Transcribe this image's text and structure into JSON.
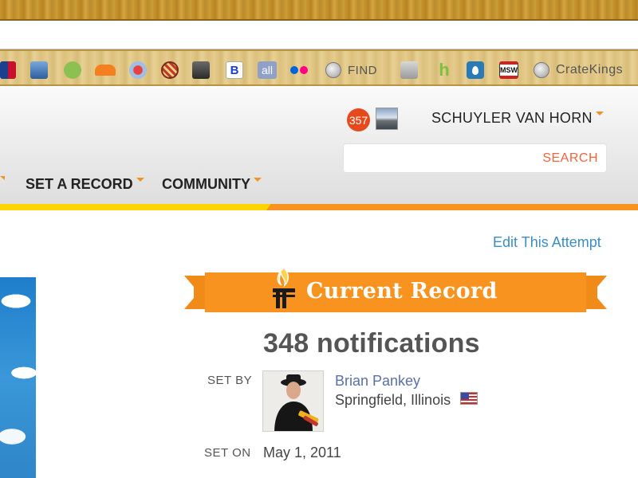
{
  "browser": {
    "bookmarks": [
      {
        "icon": "mlb-icon",
        "label": ""
      },
      {
        "icon": "city-icon",
        "label": ""
      },
      {
        "icon": "chat-bubble-icon",
        "label": ""
      },
      {
        "icon": "soundcloud-icon",
        "label": ""
      },
      {
        "icon": "map-pin-icon",
        "label": ""
      },
      {
        "icon": "striped-circle-icon",
        "label": ""
      },
      {
        "icon": "photo-icon",
        "label": ""
      },
      {
        "icon": "b-icon",
        "label": "B"
      },
      {
        "icon": "all-icon",
        "label": "all"
      },
      {
        "icon": "flickr-icon",
        "label": ""
      },
      {
        "icon": "globe-icon",
        "label": "FIND"
      },
      {
        "icon": "apple-icon",
        "label": ""
      },
      {
        "icon": "houzz-icon",
        "label": "h"
      },
      {
        "icon": "drop-icon",
        "label": ""
      },
      {
        "icon": "msw-icon",
        "label": "MSW"
      },
      {
        "icon": "globe-icon",
        "label": "CrateKings"
      }
    ]
  },
  "header": {
    "notification_count": "357",
    "user_name": "SCHUYLER VAN HORN",
    "search": {
      "placeholder": "",
      "button_label": "SEARCH"
    },
    "nav": {
      "set_record": "SET A RECORD",
      "community": "COMMUNITY"
    }
  },
  "content": {
    "edit_link": "Edit This Attempt",
    "banner_title": "Current Record",
    "record_value": "348 notifications",
    "set_by_label": "SET BY",
    "setter_name": "Brian Pankey",
    "setter_location": "Springfield, Illinois",
    "set_on_label": "SET ON",
    "set_on_value": "May 1, 2011"
  },
  "colors": {
    "accent_orange": "#f7931e",
    "accent_yellow": "#ffd500",
    "link_blue": "#3b8dc4",
    "badge_red": "#e64a1c"
  }
}
